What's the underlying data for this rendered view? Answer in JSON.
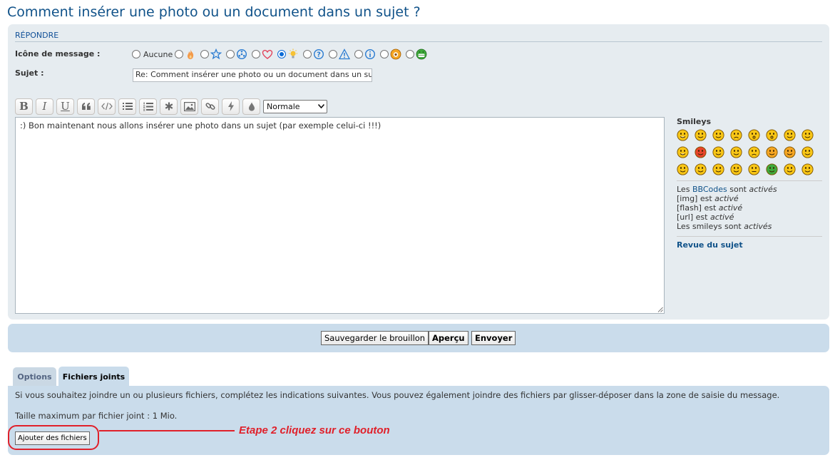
{
  "page_title": "Comment insérer une photo ou un document dans un sujet ?",
  "reply_section": {
    "heading": "RÉPONDRE",
    "icon_label": "Icône de message :",
    "icon_options": [
      {
        "label": "Aucune",
        "icon": "none",
        "selected": false
      },
      {
        "label": "",
        "icon": "fire-icon",
        "selected": false
      },
      {
        "label": "",
        "icon": "star-icon",
        "selected": false
      },
      {
        "label": "",
        "icon": "radioactive-icon",
        "selected": false
      },
      {
        "label": "",
        "icon": "heart-icon",
        "selected": false
      },
      {
        "label": "",
        "icon": "lightbulb-icon",
        "selected": true
      },
      {
        "label": "",
        "icon": "question-icon",
        "selected": false
      },
      {
        "label": "",
        "icon": "warning-icon",
        "selected": false
      },
      {
        "label": "",
        "icon": "info-icon",
        "selected": false
      },
      {
        "label": "",
        "icon": "mrgreen-icon",
        "selected": false
      },
      {
        "label": "",
        "icon": "grin-icon",
        "selected": false
      }
    ],
    "subject_label": "Sujet :",
    "subject_value": "Re: Comment insérer une photo ou un document dans un sujet ?"
  },
  "toolbar": {
    "buttons": [
      "bold",
      "italic",
      "underline",
      "quote",
      "code",
      "list",
      "list-numbered",
      "list-item",
      "image",
      "url",
      "flash",
      "color"
    ],
    "bold_label": "B",
    "italic_label": "I",
    "underline_label": "U",
    "size_value": "Normale"
  },
  "editor": {
    "text": ":) Bon maintenant nous allons insérer une photo dans un sujet (par exemple celui-ci !!!)"
  },
  "sidebar": {
    "smileys_heading": "Smileys",
    "smileys": [
      "biggrin",
      "smile",
      "wink",
      "sad",
      "surprised",
      "eek",
      "confused",
      "cool",
      "lol",
      "mad",
      "razz",
      "redface",
      "cry",
      "evil",
      "twisted",
      "rolleyes",
      "exclaim",
      "question",
      "idea",
      "arrow",
      "neutral",
      "mrgreen",
      "geek",
      "ugeek"
    ],
    "bbcode_line": {
      "prefix": "Les ",
      "link": "BBCodes",
      "mid": " sont ",
      "state": "activés"
    },
    "img_line": {
      "prefix": "[img] est ",
      "state": "activé"
    },
    "flash_line": {
      "prefix": "[flash] est ",
      "state": "activé"
    },
    "url_line": {
      "prefix": "[url] est ",
      "state": "activé"
    },
    "smileys_line": {
      "prefix": "Les smileys sont ",
      "state": "activés"
    },
    "review_link": "Revue du sujet"
  },
  "submit": {
    "save_draft": "Sauvegarder le brouillon",
    "preview": "Aperçu",
    "send": "Envoyer"
  },
  "tabs": {
    "options": "Options",
    "attachments": "Fichiers joints"
  },
  "attachments": {
    "intro": "Si vous souhaitez joindre un ou plusieurs fichiers, complétez les indications suivantes. Vous pouvez également joindre des fichiers par glisser-déposer dans la zone de saisie du message.",
    "max_size": "Taille maximum par fichier joint : 1 Mio.",
    "add_button": "Ajouter des fichiers"
  },
  "annotation": {
    "text": "Etape 2 cliquez sur ce bouton",
    "color": "#e0202a"
  }
}
